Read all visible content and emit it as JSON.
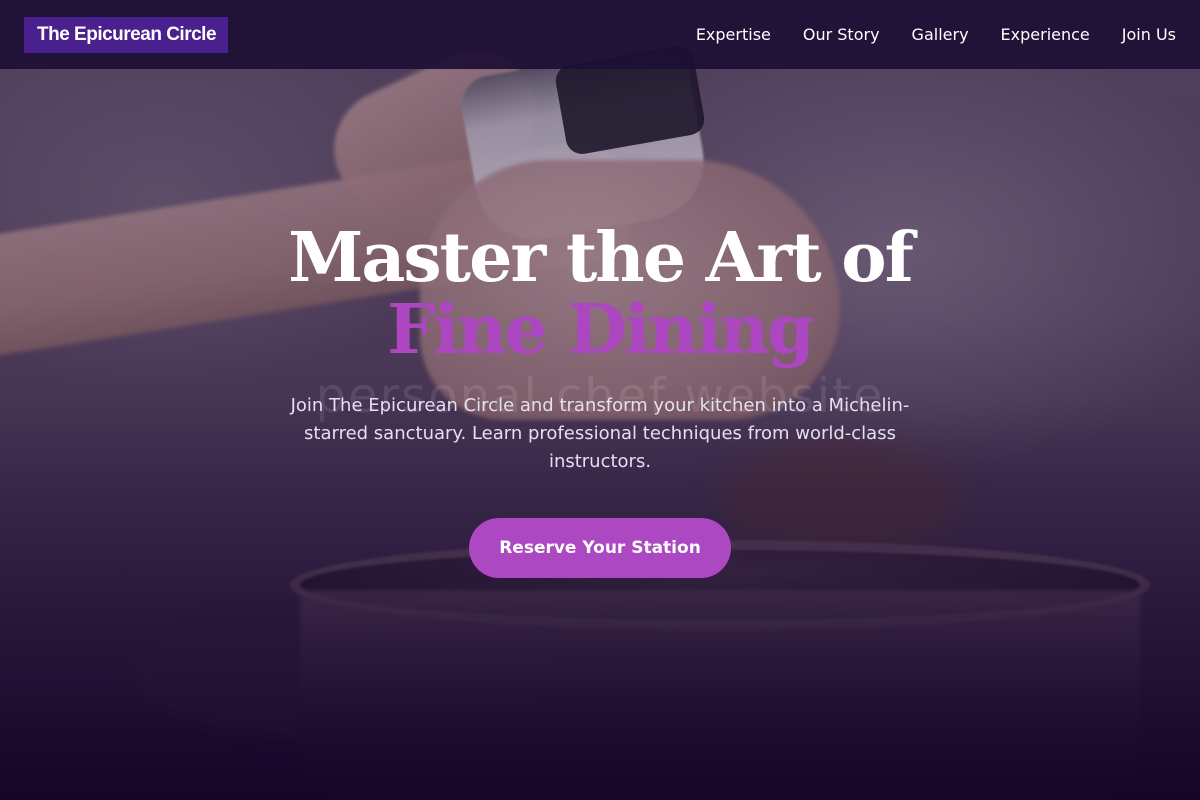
{
  "brand": {
    "name": "The Epicurean Circle"
  },
  "nav": {
    "items": [
      {
        "label": "Expertise"
      },
      {
        "label": "Our Story"
      },
      {
        "label": "Gallery"
      },
      {
        "label": "Experience"
      },
      {
        "label": "Join Us"
      }
    ]
  },
  "hero": {
    "headline_line1": "Master the Art of",
    "headline_line2": "Fine Dining",
    "watermark": "personal chef website",
    "subtitle": "Join The Epicurean Circle and transform your kitchen into a Michelin-starred sanctuary. Learn professional techniques from world-class instructors.",
    "cta_label": "Reserve Your Station"
  },
  "colors": {
    "nav_background": "#1d0e34",
    "brand_background": "#4a1f8e",
    "accent": "#ad47c1",
    "cta_background": "#ac48c1",
    "text_light": "#ffffff"
  }
}
